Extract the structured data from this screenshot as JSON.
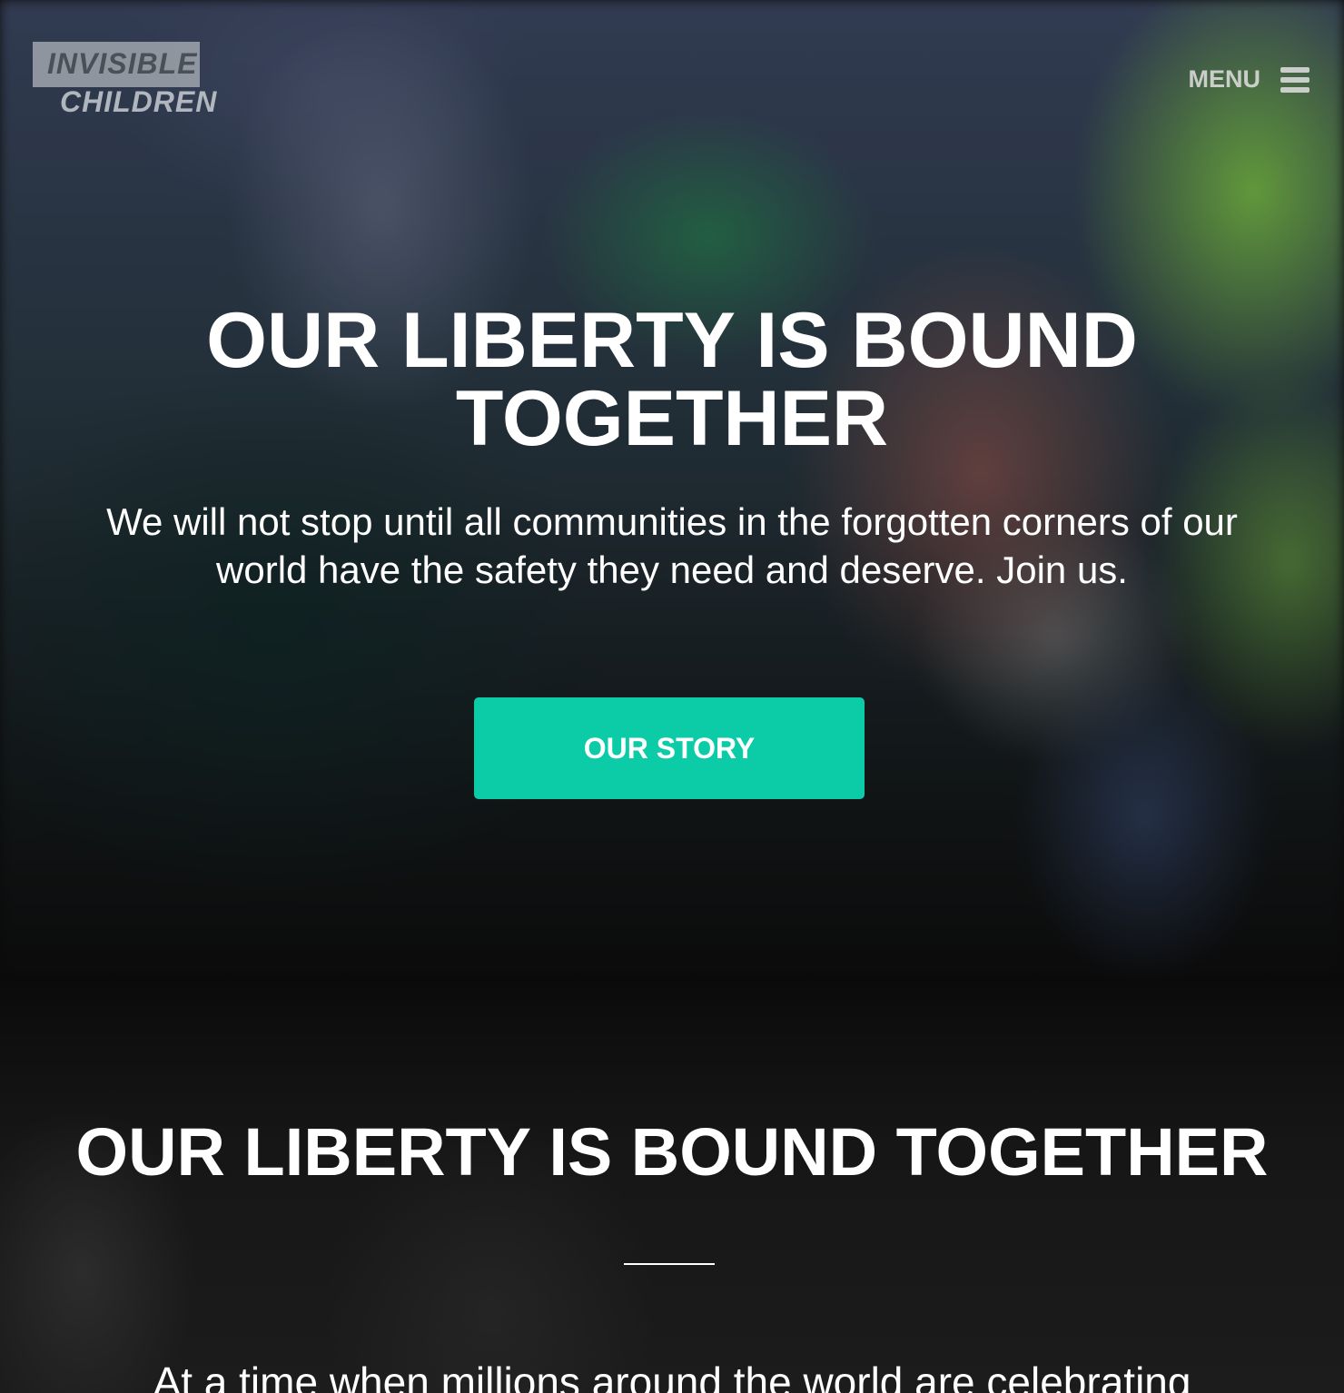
{
  "brand": {
    "line1": "INVISIBLE",
    "line2": "CHILDREN"
  },
  "nav": {
    "menu_label": "MENU",
    "menu_icon": "hamburger-icon"
  },
  "hero": {
    "title": "OUR LIBERTY IS BOUND TOGETHER",
    "subtitle": "We will not stop until all communities in the forgotten corners of our world have the safety they need and deserve. Join us.",
    "cta_label": "OUR STORY"
  },
  "section2": {
    "title": "OUR LIBERTY IS BOUND TOGETHER",
    "body": "At a time when millions around the world are celebrating"
  },
  "colors": {
    "accent": "#0ccca7",
    "text": "#ffffff",
    "section_bg": "#141414"
  }
}
